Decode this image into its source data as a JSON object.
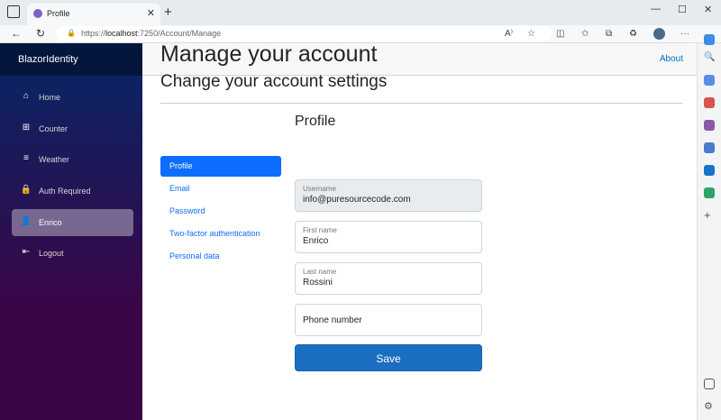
{
  "browser": {
    "tab_title": "Profile",
    "url_prefix": "https://",
    "url_host": "localhost",
    "url_rest": ":7250/Account/Manage"
  },
  "app": {
    "brand": "BlazorIdentity",
    "about_link": "About",
    "nav": [
      {
        "label": "Home",
        "icon": "home-icon"
      },
      {
        "label": "Counter",
        "icon": "plus-square-icon"
      },
      {
        "label": "Weather",
        "icon": "list-icon"
      },
      {
        "label": "Auth Required",
        "icon": "lock-icon"
      },
      {
        "label": "Enrico",
        "icon": "person-icon"
      },
      {
        "label": "Logout",
        "icon": "logout-icon"
      }
    ],
    "active_nav": "Enrico"
  },
  "page": {
    "title": "Manage your account",
    "subtitle": "Change your account settings",
    "section_title": "Profile",
    "menu": [
      "Profile",
      "Email",
      "Password",
      "Two-factor authentication",
      "Personal data"
    ],
    "active_menu": "Profile"
  },
  "form": {
    "username": {
      "label": "Username",
      "value": "info@puresourcecode.com"
    },
    "first_name": {
      "label": "First name",
      "value": "Enrico"
    },
    "last_name": {
      "label": "Last name",
      "value": "Rossini"
    },
    "phone": {
      "label": "Phone number",
      "value": ""
    },
    "save_label": "Save"
  },
  "colors": {
    "primary": "#0d6efd",
    "save_button": "#1b6ec2",
    "sidebar_top": "#052767",
    "sidebar_bottom": "#3a0647"
  }
}
